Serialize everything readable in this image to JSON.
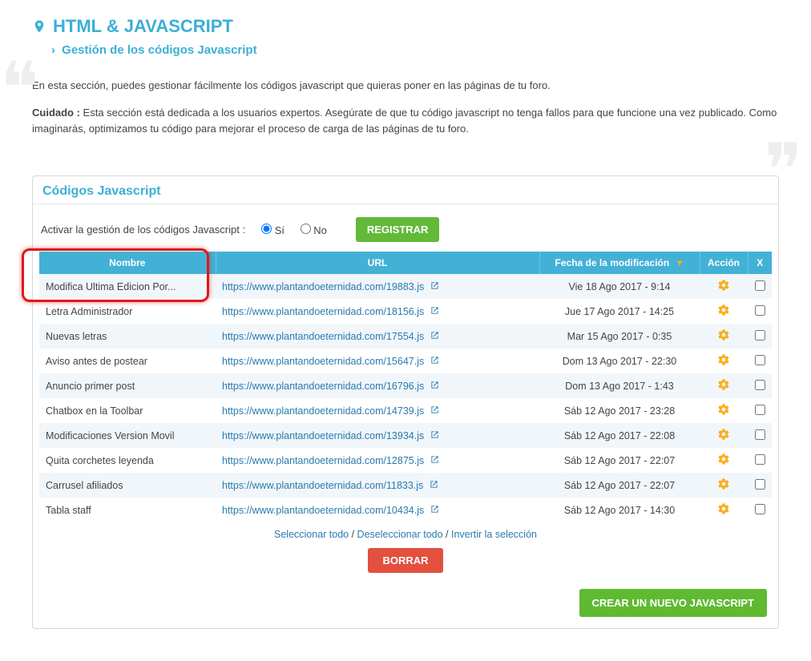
{
  "header": {
    "title": "HTML & JAVASCRIPT",
    "breadcrumb": "Gestión de los códigos Javascript"
  },
  "intro": {
    "line1": "En esta sección, puedes gestionar fácilmente los códigos javascript que quieras poner en las páginas de tu foro.",
    "careful_label": "Cuidado :",
    "careful_text": " Esta sección está dedicada a los usuarios expertos. Asegúrate de que tu código javascript no tenga fallos para que funcione una vez publicado. Como imaginarás, optimizamos tu código para mejorar el proceso de carga de las páginas de tu foro."
  },
  "panel": {
    "title": "Códigos Javascript",
    "activate_label": "Activar la gestión de los códigos Javascript :",
    "radio_yes": "Sí",
    "radio_no": "No",
    "register_btn": "REGISTRAR"
  },
  "table": {
    "headers": {
      "name": "Nombre",
      "url": "URL",
      "date": "Fecha de la modificación",
      "action": "Acción",
      "x": "X"
    },
    "rows": [
      {
        "name": "Modifica Ultima Edicion Por...",
        "url": "https://www.plantandoeternidad.com/19883.js",
        "date": "Vie 18 Ago 2017 - 9:14"
      },
      {
        "name": "Letra Administrador",
        "url": "https://www.plantandoeternidad.com/18156.js",
        "date": "Jue 17 Ago 2017 - 14:25"
      },
      {
        "name": "Nuevas letras",
        "url": "https://www.plantandoeternidad.com/17554.js",
        "date": "Mar 15 Ago 2017 - 0:35"
      },
      {
        "name": "Aviso antes de postear",
        "url": "https://www.plantandoeternidad.com/15647.js",
        "date": "Dom 13 Ago 2017 - 22:30"
      },
      {
        "name": "Anuncio primer post",
        "url": "https://www.plantandoeternidad.com/16796.js",
        "date": "Dom 13 Ago 2017 - 1:43"
      },
      {
        "name": "Chatbox en la Toolbar",
        "url": "https://www.plantandoeternidad.com/14739.js",
        "date": "Sáb 12 Ago 2017 - 23:28"
      },
      {
        "name": "Modificaciones Version Movil",
        "url": "https://www.plantandoeternidad.com/13934.js",
        "date": "Sáb 12 Ago 2017 - 22:08"
      },
      {
        "name": "Quita corchetes leyenda",
        "url": "https://www.plantandoeternidad.com/12875.js",
        "date": "Sáb 12 Ago 2017 - 22:07"
      },
      {
        "name": "Carrusel afiliados",
        "url": "https://www.plantandoeternidad.com/11833.js",
        "date": "Sáb 12 Ago 2017 - 22:07"
      },
      {
        "name": "Tabla staff",
        "url": "https://www.plantandoeternidad.com/10434.js",
        "date": "Sáb 12 Ago 2017 - 14:30"
      }
    ]
  },
  "selection": {
    "select_all": "Seleccionar todo",
    "deselect_all": "Deseleccionar todo",
    "invert": "Invertir la selección",
    "sep": " / "
  },
  "buttons": {
    "delete": "BORRAR",
    "create": "CREAR UN NUEVO JAVASCRIPT"
  },
  "icons": {
    "gear": "gear-icon",
    "external": "external-link-icon",
    "pin": "map-pin-icon",
    "sort": "sort-desc-icon"
  }
}
